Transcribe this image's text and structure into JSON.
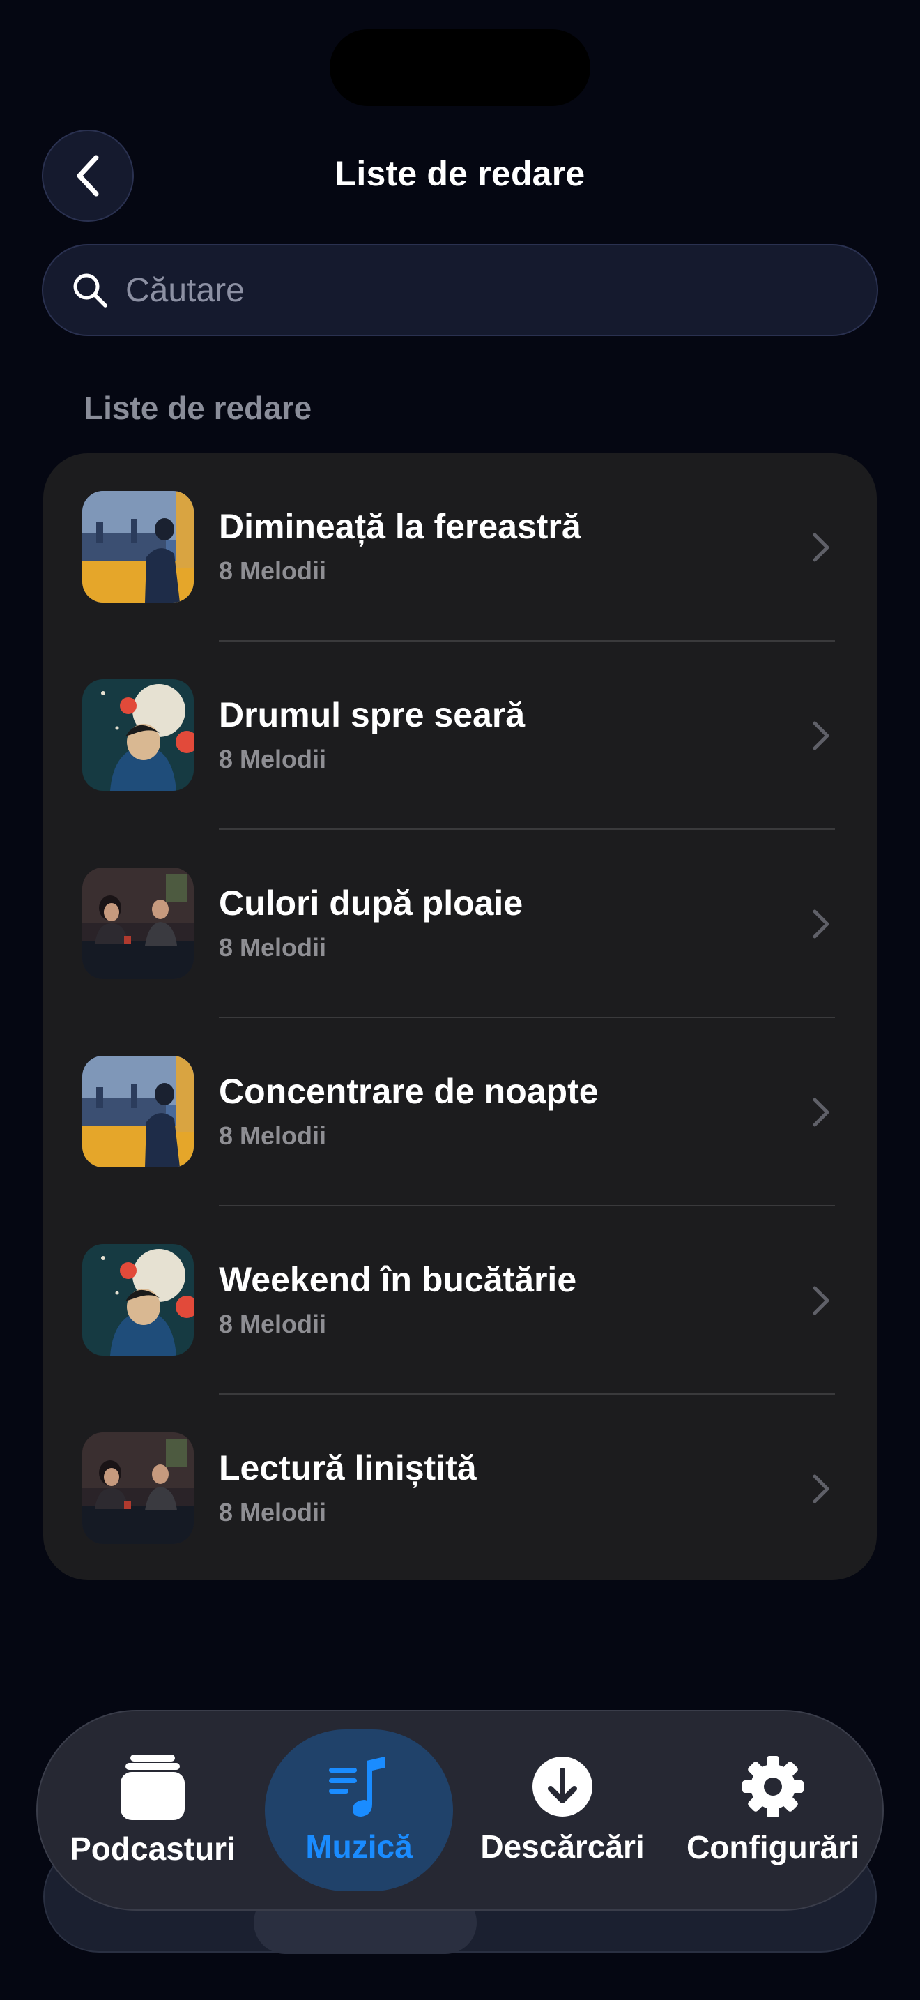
{
  "header": {
    "title": "Liste de redare"
  },
  "search": {
    "placeholder": "Căutare"
  },
  "section": {
    "label": "Liste de redare"
  },
  "playlists": [
    {
      "title": "Dimineață la fereastră",
      "subtitle": "8 Melodii",
      "art": "city-window"
    },
    {
      "title": "Drumul spre seară",
      "subtitle": "8 Melodii",
      "art": "illustration-moon"
    },
    {
      "title": "Culori după ploaie",
      "subtitle": "8 Melodii",
      "art": "two-people-table"
    },
    {
      "title": "Concentrare de noapte",
      "subtitle": "8 Melodii",
      "art": "city-window"
    },
    {
      "title": "Weekend în bucătărie",
      "subtitle": "8 Melodii",
      "art": "illustration-moon"
    },
    {
      "title": "Lectură liniștită",
      "subtitle": "8 Melodii",
      "art": "two-people-table"
    }
  ],
  "tabbar": {
    "tabs": [
      {
        "label": "Podcasturi",
        "icon": "stack-icon",
        "active": false
      },
      {
        "label": "Muzică",
        "icon": "music-note-icon",
        "active": true
      },
      {
        "label": "Descărcări",
        "icon": "download-circle-icon",
        "active": false
      },
      {
        "label": "Configurări",
        "icon": "gear-icon",
        "active": false
      }
    ]
  },
  "colors": {
    "background": "#050712",
    "card": "#1c1c1e",
    "accent": "#1a8cff",
    "secondary_text": "#8e8e93"
  }
}
